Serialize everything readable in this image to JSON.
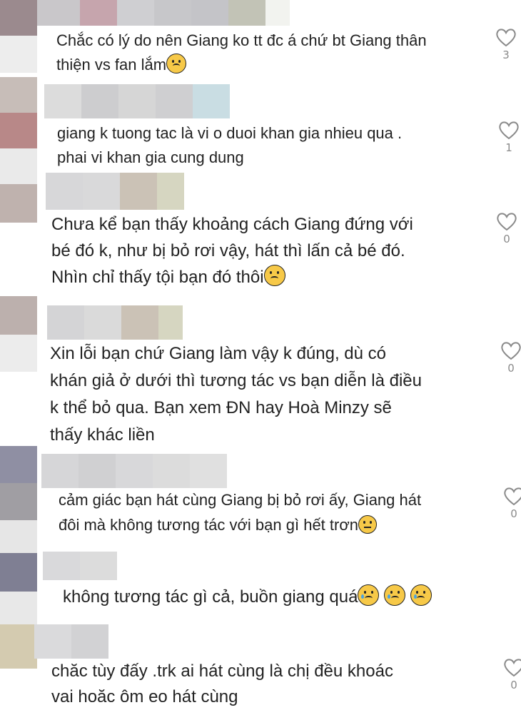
{
  "comments": [
    {
      "text": "Chắc có lý do nên Giang ko tt đc á chứ bt Giang thân\nthiện vs fan lắm",
      "emoji": "sad-face",
      "likes": "3"
    },
    {
      "text": "giang k tuong tac là vi o duoi khan gia nhieu qua .\nphai vi khan gia cung dung",
      "likes": "1"
    },
    {
      "text": "Chưa kể bạn thấy khoảng cách Giang đứng với\nbé đó k, như bị bỏ rơi vậy, hát thì lấn cả bé đó.\nNhìn chỉ thấy tội bạn đó thôi",
      "emoji": "sad-face",
      "likes": "0"
    },
    {
      "text": "Xin lỗi bạn chứ Giang làm vậy k đúng, dù có\nkhán giả ở dưới thì tương tác vs bạn diễn là điều\nk thể bỏ qua. Bạn xem ĐN hay Hoà Minzy sẽ\nthấy khác liền",
      "likes": "0"
    },
    {
      "text": "cảm giác bạn hát cùng Giang bị bỏ rơi ấy, Giang hát\nđôi mà không tương tác với bạn gì hết trơn",
      "emoji": "neutral-face",
      "likes": "0"
    },
    {
      "text": "không tương tác gì cả, buồn giang quá",
      "emoji": "crying-face x3"
    },
    {
      "text": "chăc tùy đấy .trk ai hát cùng là chị đều khoác\nvai hoăc ôm eo hát cùng",
      "likes": "0"
    }
  ],
  "icons": {
    "like": "heart-outline-icon"
  },
  "colors": {
    "text": "#222222",
    "like_count": "#8a8a8a",
    "heart_stroke": "#8a8a8a",
    "emoji_face": "#f7c948"
  }
}
